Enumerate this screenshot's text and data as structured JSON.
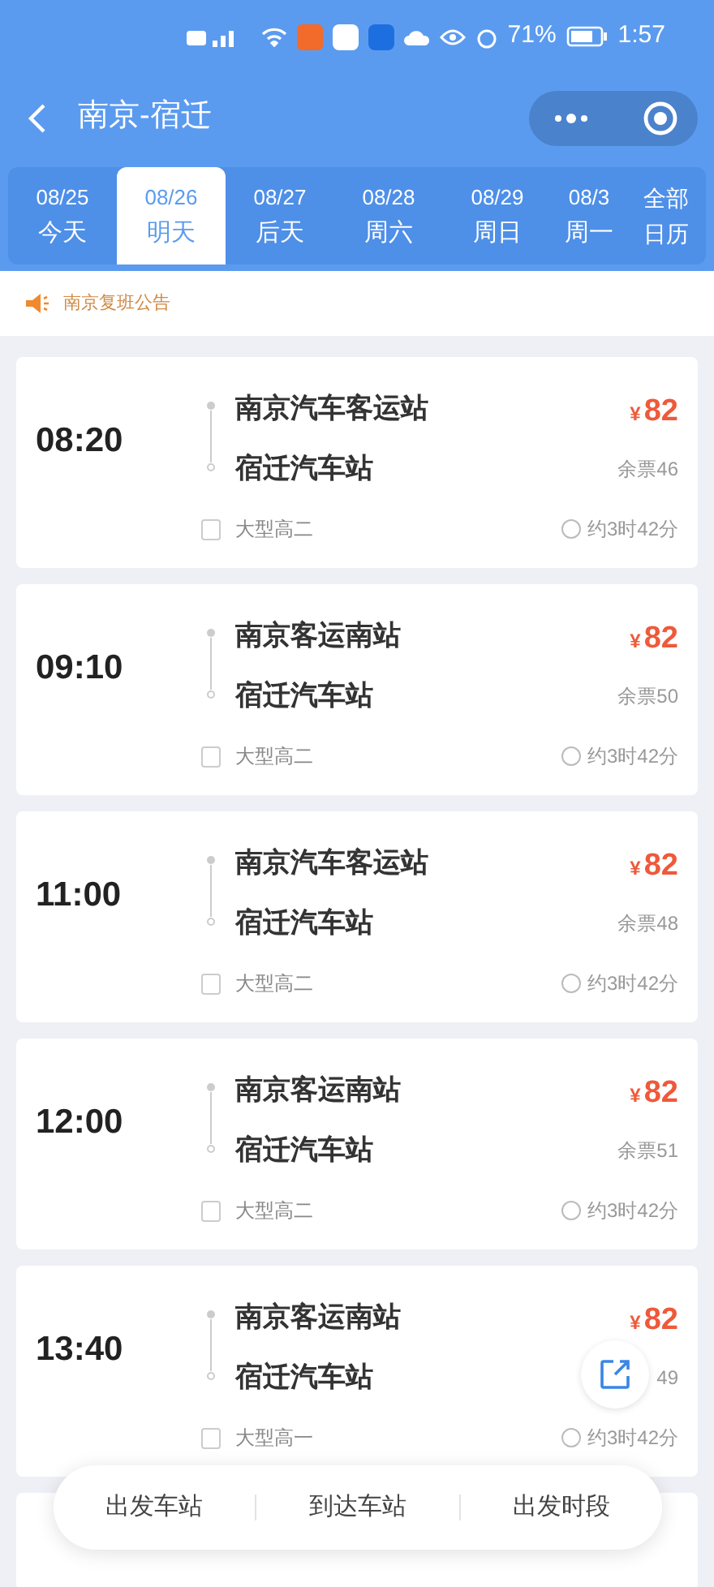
{
  "status_bar": {
    "battery_text": "71%",
    "time": "1:57"
  },
  "header": {
    "title": "南京-宿迁"
  },
  "date_tabs": [
    {
      "date": "08/25",
      "label": "今天",
      "selected": false
    },
    {
      "date": "08/26",
      "label": "明天",
      "selected": true
    },
    {
      "date": "08/27",
      "label": "后天",
      "selected": false
    },
    {
      "date": "08/28",
      "label": "周六",
      "selected": false
    },
    {
      "date": "08/29",
      "label": "周日",
      "selected": false
    },
    {
      "date": "08/3",
      "label": "周一",
      "selected": false
    }
  ],
  "calendar_button": {
    "line1": "全部",
    "line2": "日历"
  },
  "notice": {
    "text": "南京复班公告"
  },
  "trips": [
    {
      "time": "08:20",
      "from": "南京汽车客运站",
      "to": "宿迁汽车站",
      "bus_type": "大型高二",
      "price_symbol": "¥",
      "price": "82",
      "remaining": "余票46",
      "duration": "约3时42分"
    },
    {
      "time": "09:10",
      "from": "南京客运南站",
      "to": "宿迁汽车站",
      "bus_type": "大型高二",
      "price_symbol": "¥",
      "price": "82",
      "remaining": "余票50",
      "duration": "约3时42分"
    },
    {
      "time": "11:00",
      "from": "南京汽车客运站",
      "to": "宿迁汽车站",
      "bus_type": "大型高二",
      "price_symbol": "¥",
      "price": "82",
      "remaining": "余票48",
      "duration": "约3时42分"
    },
    {
      "time": "12:00",
      "from": "南京客运南站",
      "to": "宿迁汽车站",
      "bus_type": "大型高二",
      "price_symbol": "¥",
      "price": "82",
      "remaining": "余票51",
      "duration": "约3时42分"
    },
    {
      "time": "13:40",
      "from": "南京客运南站",
      "to": "宿迁汽车站",
      "bus_type": "大型高一",
      "price_symbol": "¥",
      "price": "82",
      "remaining": "49",
      "duration": "约3时42分"
    }
  ],
  "filter_bar": [
    "出发车站",
    "到达车站",
    "出发时段"
  ]
}
